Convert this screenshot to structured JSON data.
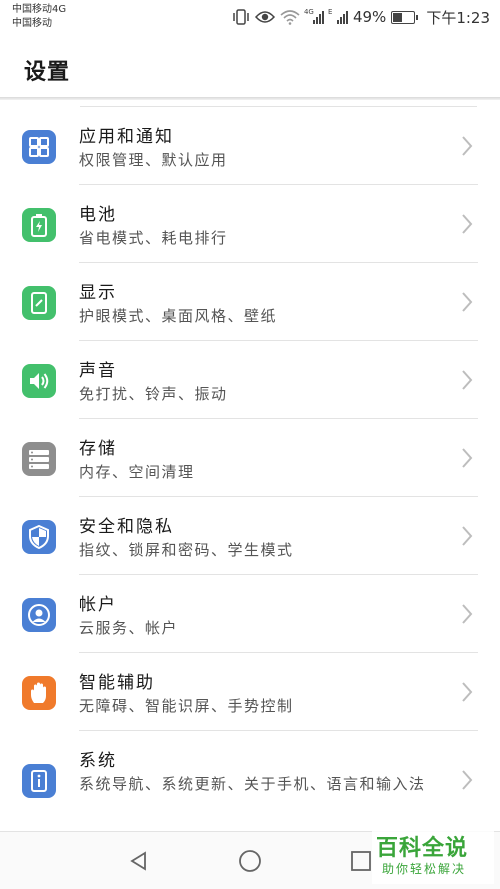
{
  "status_bar": {
    "carrier_line1": "中国移动4G",
    "carrier_line2": "中国移动",
    "signal1_tag": "4G",
    "signal2_tag": "E",
    "battery_percent": "49%",
    "battery_level": 0.49,
    "time": "下午1:23",
    "icons": [
      "vibrate-icon",
      "eye-comfort-icon",
      "wifi-icon",
      "signal-icon",
      "battery-charging-icon"
    ]
  },
  "header": {
    "title": "设置"
  },
  "settings": {
    "items": [
      {
        "title": "应用和通知",
        "subtitle": "权限管理、默认应用",
        "icon": "apps-grid-icon",
        "color": "#4a7fd4"
      },
      {
        "title": "电池",
        "subtitle": "省电模式、耗电排行",
        "icon": "battery-icon",
        "color": "#43c06c"
      },
      {
        "title": "显示",
        "subtitle": "护眼模式、桌面风格、壁纸",
        "icon": "display-icon",
        "color": "#43c06c"
      },
      {
        "title": "声音",
        "subtitle": "免打扰、铃声、振动",
        "icon": "speaker-icon",
        "color": "#43c06c"
      },
      {
        "title": "存储",
        "subtitle": "内存、空间清理",
        "icon": "storage-icon",
        "color": "#8e8e8e"
      },
      {
        "title": "安全和隐私",
        "subtitle": "指纹、锁屏和密码、学生模式",
        "icon": "shield-icon",
        "color": "#4a7fd4"
      },
      {
        "title": "帐户",
        "subtitle": "云服务、帐户",
        "icon": "account-icon",
        "color": "#4a7fd4"
      },
      {
        "title": "智能辅助",
        "subtitle": "无障碍、智能识屏、手势控制",
        "icon": "hand-icon",
        "color": "#f07a2b"
      },
      {
        "title": "系统",
        "subtitle": "系统导航、系统更新、关于手机、语言和输入法",
        "icon": "info-icon",
        "color": "#4a7fd4"
      }
    ]
  },
  "nav_bar": {
    "buttons": [
      "back-icon",
      "home-icon",
      "recents-icon"
    ]
  },
  "watermark": {
    "main": "百科全说",
    "sub": "助你轻松解决"
  }
}
